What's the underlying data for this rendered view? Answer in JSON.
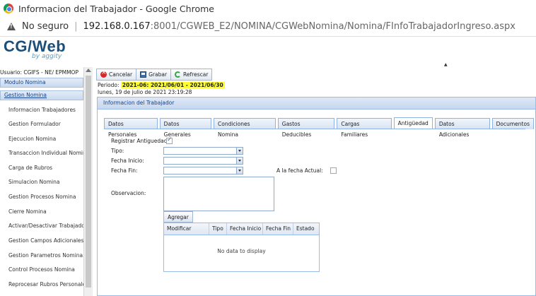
{
  "window": {
    "title": "Informacion del Trabajador - Google Chrome",
    "security_label": "No seguro",
    "url_host": "192.168.0.167",
    "url_rest": ":8001/CGWEB_E2/NOMINA/CGWebNomina/Nomina/FInfoTrabajadorIngreso.aspx"
  },
  "brand": {
    "logo": "CG/Web",
    "sub": "by aggity"
  },
  "sidebar": {
    "user": "Usuario: CGIFS - NE/ EPMMOP",
    "sections": [
      "Modulo Nomina",
      "Gestion Nomina"
    ],
    "items": [
      "Informacion Trabajadores",
      "Gestion Formulador",
      "Ejecucion Nomina",
      "Transaccion Individual Nomina",
      "Carga de Rubros",
      "Simulacion Nomina",
      "Gestion Procesos Nomina",
      "Cierre Nomina",
      "Activar/Desactivar Trabajadores",
      "Gestion Campos Adicionales",
      "Gestion Parametros Nomina",
      "Control Procesos Nomina",
      "Reprocesar Rubros Personales"
    ]
  },
  "toolbar": {
    "cancel": "Cancelar",
    "save": "Grabar",
    "refresh": "Refrescar"
  },
  "period": {
    "label": "Periodo:",
    "value": "2021-06: 2021/06/01 - 2021/06/30",
    "date": "lunes, 19 de julio de 2021 23:19:28"
  },
  "panel_title": "Informacion del Trabajador",
  "tabs": [
    "Datos Personales",
    "Datos Generales",
    "Condiciones Nomina",
    "Gastos Deducibles",
    "Cargas Familiares",
    "Antigüedad",
    "Datos Adicionales",
    "Documentos"
  ],
  "active_tab": "Antigüedad",
  "form": {
    "register_label": "Registrar Antiguedad",
    "register_checked": true,
    "tipo_label": "Tipo:",
    "fecha_inicio_label": "Fecha Inicio:",
    "fecha_fin_label": "Fecha Fin:",
    "fecha_actual_label": "A la fecha Actual:",
    "observacion_label": "Observacion:",
    "add_button": "Agregar"
  },
  "grid": {
    "columns": [
      "Modificar",
      "Tipo",
      "Fecha Inicio",
      "Fecha Fin",
      "Estado"
    ],
    "empty_text": "No data to display"
  }
}
